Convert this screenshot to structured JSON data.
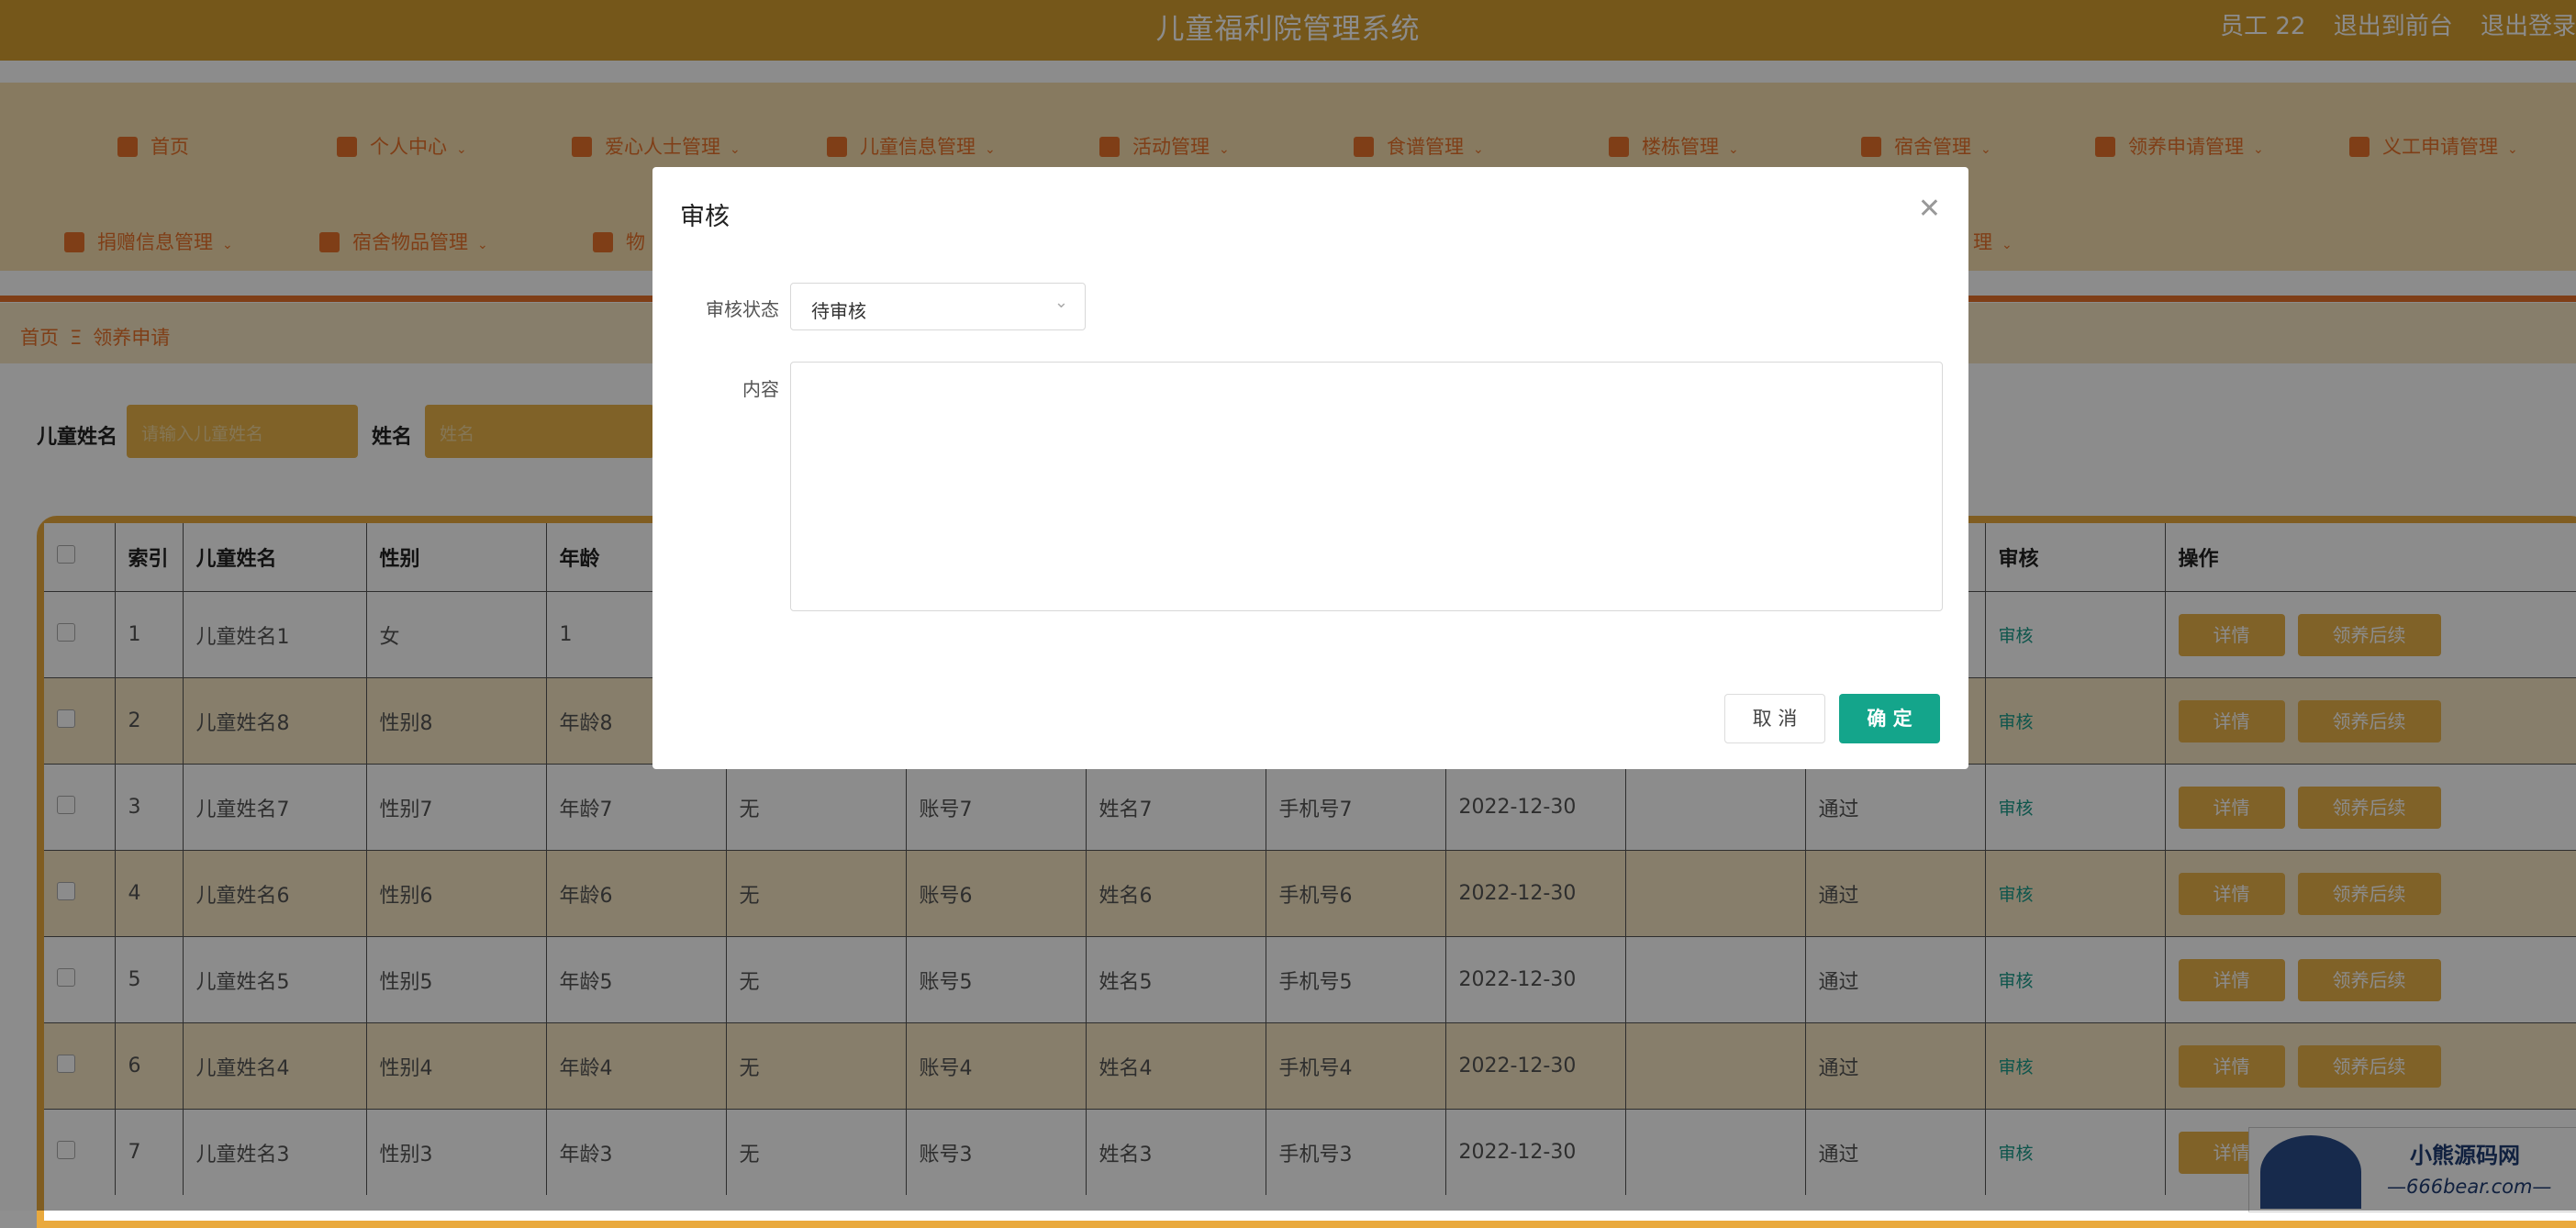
{
  "header": {
    "title": "儿童福利院管理系统",
    "user": "员工 22",
    "to_front": "退出到前台",
    "logout": "退出登录"
  },
  "nav": {
    "row1": [
      {
        "label": "首页",
        "icon": "home-icon"
      },
      {
        "label": "个人中心",
        "icon": "user-icon"
      },
      {
        "label": "爱心人士管理",
        "icon": "location-icon"
      },
      {
        "label": "儿童信息管理",
        "icon": "grid-icon"
      },
      {
        "label": "活动管理",
        "icon": "list-icon"
      },
      {
        "label": "食谱管理",
        "icon": "send-icon"
      },
      {
        "label": "楼栋管理",
        "icon": "grid-icon"
      },
      {
        "label": "宿舍管理",
        "icon": "user-icon"
      },
      {
        "label": "领养申请管理",
        "icon": "grid-icon"
      },
      {
        "label": "义工申请管理",
        "icon": "list-icon"
      }
    ],
    "row2": [
      {
        "label": "捐赠信息管理",
        "icon": "sliders-icon"
      },
      {
        "label": "宿舍物品管理",
        "icon": "grid-icon"
      },
      {
        "label": "物",
        "icon": "grid-icon"
      },
      {
        "label": "理",
        "icon": "none"
      }
    ]
  },
  "breadcrumb": {
    "home": "首页",
    "separator": "Ξ",
    "current": "领养申请"
  },
  "search": {
    "child_name_label": "儿童姓名",
    "child_name_placeholder": "请输入儿童姓名",
    "name_label": "姓名",
    "name_placeholder": "姓名"
  },
  "table": {
    "headers": [
      "",
      "索引",
      "儿童姓名",
      "性别",
      "年龄",
      "",
      "",
      "",
      "",
      "",
      "",
      "",
      "审核",
      "操作"
    ],
    "rows": [
      {
        "index": "1",
        "child": "儿童姓名1",
        "gender": "女",
        "age": "1",
        "c5": "",
        "c6": "",
        "c7": "",
        "c8": "",
        "c9": "",
        "c10": "",
        "c11": "",
        "audit": "审核"
      },
      {
        "index": "2",
        "child": "儿童姓名8",
        "gender": "性别8",
        "age": "年龄8",
        "c5": "",
        "c6": "",
        "c7": "",
        "c8": "",
        "c9": "",
        "c10": "",
        "c11": "",
        "audit": "审核"
      },
      {
        "index": "3",
        "child": "儿童姓名7",
        "gender": "性别7",
        "age": "年龄7",
        "c5": "无",
        "c6": "账号7",
        "c7": "姓名7",
        "c8": "手机号7",
        "c9": "2022-12-30",
        "c10": "",
        "c11": "通过",
        "audit": "审核"
      },
      {
        "index": "4",
        "child": "儿童姓名6",
        "gender": "性别6",
        "age": "年龄6",
        "c5": "无",
        "c6": "账号6",
        "c7": "姓名6",
        "c8": "手机号6",
        "c9": "2022-12-30",
        "c10": "",
        "c11": "通过",
        "audit": "审核"
      },
      {
        "index": "5",
        "child": "儿童姓名5",
        "gender": "性别5",
        "age": "年龄5",
        "c5": "无",
        "c6": "账号5",
        "c7": "姓名5",
        "c8": "手机号5",
        "c9": "2022-12-30",
        "c10": "",
        "c11": "通过",
        "audit": "审核"
      },
      {
        "index": "6",
        "child": "儿童姓名4",
        "gender": "性别4",
        "age": "年龄4",
        "c5": "无",
        "c6": "账号4",
        "c7": "姓名4",
        "c8": "手机号4",
        "c9": "2022-12-30",
        "c10": "",
        "c11": "通过",
        "audit": "审核"
      },
      {
        "index": "7",
        "child": "儿童姓名3",
        "gender": "性别3",
        "age": "年龄3",
        "c5": "无",
        "c6": "账号3",
        "c7": "姓名3",
        "c8": "手机号3",
        "c9": "2022-12-30",
        "c10": "",
        "c11": "通过",
        "audit": "审核"
      }
    ],
    "detail_btn": "详情",
    "followup_btn": "领养后续"
  },
  "dialog": {
    "title": "审核",
    "status_label": "审核状态",
    "status_value": "待审核",
    "content_label": "内容",
    "content_value": "",
    "cancel": "取 消",
    "confirm": "确 定"
  },
  "watermark": {
    "line1": "小熊源码网",
    "line2": "—666bear.com—"
  },
  "colors": {
    "primary": "#d69e30",
    "accent": "#e8722a",
    "confirm": "#14a58b",
    "row_alt": "#f6e6c4"
  }
}
